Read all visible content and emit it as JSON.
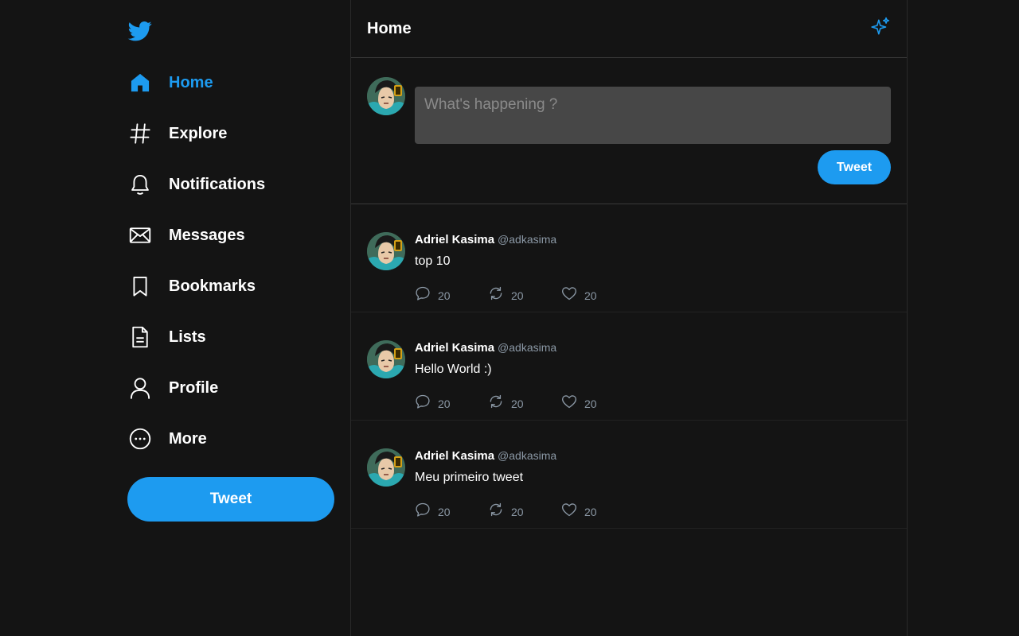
{
  "sidebar": {
    "logo_icon": "twitter-bird-icon",
    "items": [
      {
        "label": "Home",
        "icon": "home-icon",
        "active": true
      },
      {
        "label": "Explore",
        "icon": "hashtag-icon"
      },
      {
        "label": "Notifications",
        "icon": "bell-icon"
      },
      {
        "label": "Messages",
        "icon": "envelope-icon"
      },
      {
        "label": "Bookmarks",
        "icon": "bookmark-icon"
      },
      {
        "label": "Lists",
        "icon": "list-document-icon"
      },
      {
        "label": "Profile",
        "icon": "user-icon"
      },
      {
        "label": "More",
        "icon": "more-circle-icon"
      }
    ],
    "tweet_button_label": "Tweet"
  },
  "header": {
    "title": "Home",
    "sparkle_icon": "sparkle-icon"
  },
  "composer": {
    "placeholder": "What's happening ?",
    "value": "",
    "button_label": "Tweet"
  },
  "tweets": [
    {
      "name": "Adriel Kasima",
      "handle": "@adkasima",
      "text": "top 10",
      "replies": "20",
      "retweets": "20",
      "likes": "20"
    },
    {
      "name": "Adriel Kasima",
      "handle": "@adkasima",
      "text": "Hello World :)",
      "replies": "20",
      "retweets": "20",
      "likes": "20"
    },
    {
      "name": "Adriel Kasima",
      "handle": "@adkasima",
      "text": "Meu primeiro tweet",
      "replies": "20",
      "retweets": "20",
      "likes": "20"
    }
  ],
  "colors": {
    "background": "#141414",
    "accent": "#1d9bf0",
    "muted_text": "#8b98a5",
    "input_background": "#474747"
  }
}
